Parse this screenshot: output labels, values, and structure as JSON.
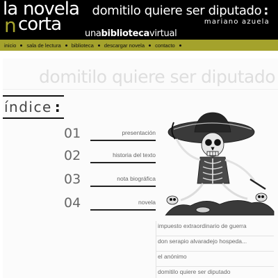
{
  "header": {
    "logo": {
      "line1a": "la",
      "line1b": "novela",
      "line2_accent": "n",
      "line2": "corta"
    },
    "tagline_pre": "una",
    "tagline_bold": "biblioteca",
    "tagline_post": "virtual",
    "title": "domitilo quiere ser diputado",
    "title_colon": ":",
    "author": "mariano azuela"
  },
  "nav": {
    "items": [
      {
        "label": "inicio"
      },
      {
        "label": "sala de lectura"
      },
      {
        "label": "biblioteca"
      },
      {
        "label": "descargar novela"
      },
      {
        "label": "contacto"
      }
    ]
  },
  "page": {
    "heading": "domitilo quiere ser diputado",
    "indice_label": "índice",
    "indice_colon": ":"
  },
  "toc": [
    {
      "num": "01",
      "label": "presentación"
    },
    {
      "num": "02",
      "label": "historia del texto"
    },
    {
      "num": "03",
      "label": "nota biográfica"
    },
    {
      "num": "04",
      "label": "novela"
    }
  ],
  "chapters": [
    {
      "label": "impuesto extraordinario de guerra"
    },
    {
      "label": "don serapio alvaradejo hospeda..."
    },
    {
      "label": "el anónimo"
    },
    {
      "label": "domitilo quiere ser diputado"
    }
  ],
  "colors": {
    "header_bg": "#000000",
    "accent": "#a4a22c"
  }
}
